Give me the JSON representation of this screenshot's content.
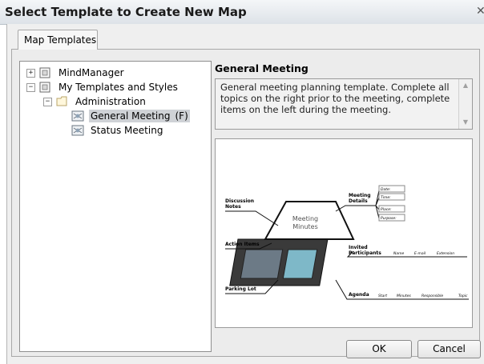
{
  "window": {
    "title": "Select Template to Create New Map"
  },
  "tabs": [
    {
      "label": "Map Templates",
      "selected": true
    }
  ],
  "tree": {
    "items": [
      {
        "label": "MindManager",
        "expander": "+",
        "icon": "template-group-icon"
      },
      {
        "label": "My Templates and Styles",
        "expander": "−",
        "icon": "template-group-icon"
      },
      {
        "label": "Administration",
        "expander": "−",
        "icon": "folder-icon"
      },
      {
        "label": "General Meeting",
        "hotkey": "(F)",
        "icon": "map-template-icon",
        "selected": true
      },
      {
        "label": "Status Meeting",
        "icon": "map-template-icon"
      }
    ]
  },
  "detail": {
    "heading": "General Meeting",
    "description": "General meeting planning template. Complete all topics on the right prior to the meeting, complete items on the left during the meeting."
  },
  "preview": {
    "center": [
      "Meeting",
      "Minutes"
    ],
    "left_topics": [
      {
        "lines": [
          "Discussion",
          "Notes"
        ]
      },
      {
        "lines": [
          "Action Items"
        ]
      },
      {
        "lines": [
          "Parking Lot"
        ]
      }
    ],
    "right_topics": [
      {
        "lines": [
          "Meeting",
          "Details"
        ]
      },
      {
        "lines": [
          "Invited",
          "Participants"
        ]
      },
      {
        "lines": [
          "Agenda"
        ]
      }
    ],
    "details_subtopics": [
      "Date:",
      "Time:",
      "Place:",
      "Purpose:"
    ],
    "participant_subtopics": [
      "Name",
      "E-mail",
      "Extension"
    ],
    "agenda_subtopics": [
      "Start",
      "Minutes",
      "Responsible",
      "Topic"
    ]
  },
  "buttons": {
    "ok": "OK",
    "cancel": "Cancel"
  },
  "colors": {
    "accent": "#a8b8c8",
    "selection": "#cfd2d6"
  }
}
